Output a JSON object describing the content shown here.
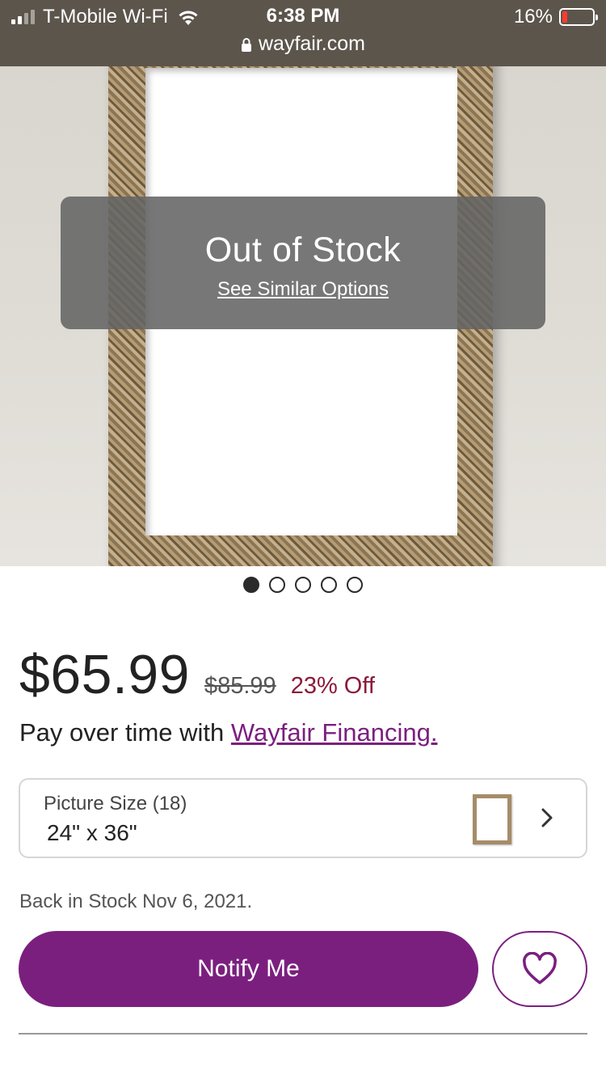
{
  "status_bar": {
    "carrier": "T-Mobile Wi-Fi",
    "time": "6:38 PM",
    "battery_percent": "16%",
    "battery_level": 0.16,
    "url": "wayfair.com"
  },
  "hero": {
    "overlay_title": "Out of Stock",
    "overlay_link": "See Similar Options",
    "carousel": {
      "count": 5,
      "active_index": 0
    }
  },
  "pricing": {
    "price": "$65.99",
    "original_price": "$85.99",
    "discount": "23% Off"
  },
  "financing": {
    "prefix": "Pay over time with ",
    "link_text": "Wayfair Financing."
  },
  "size_selector": {
    "label": "Picture Size (18)",
    "value": "24\" x 36\""
  },
  "stock_message": "Back in Stock Nov 6, 2021.",
  "actions": {
    "notify_label": "Notify Me"
  },
  "colors": {
    "brand_purple": "#7b1f7f",
    "discount_red": "#8b1a3a",
    "status_bar_bg": "#5c554c",
    "battery_low": "#ff3b30"
  },
  "icons": {
    "wifi": "wifi-icon",
    "lock": "lock-icon",
    "battery": "battery-icon",
    "chevron": "chevron-right-icon",
    "favorite": "heart-icon"
  }
}
